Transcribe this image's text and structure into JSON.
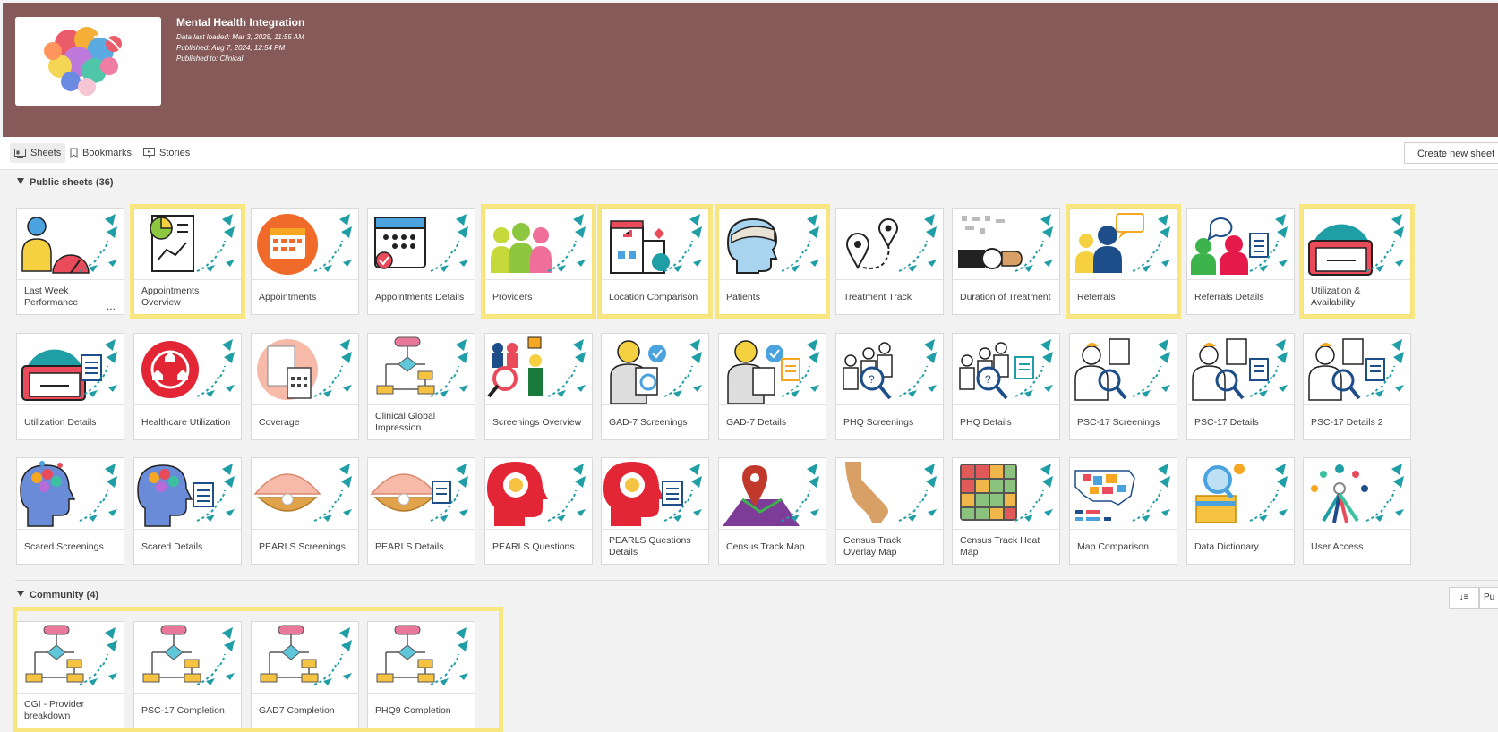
{
  "app": {
    "title": "Mental Health Integration",
    "data_last_loaded": "Data last loaded: Mar 3, 2025, 11:55 AM",
    "published": "Published: Aug 7, 2024, 12:54 PM",
    "published_to": "Published to: Clinical"
  },
  "tabs": [
    {
      "label": "Sheets",
      "icon": "sheets-icon",
      "active": true
    },
    {
      "label": "Bookmarks",
      "icon": "bookmark-icon",
      "active": false
    },
    {
      "label": "Stories",
      "icon": "stories-icon",
      "active": false
    }
  ],
  "create_sheet_label": "Create new sheet",
  "public_section": {
    "title": "Public sheets (36)",
    "sheets": [
      {
        "label": "Last Week Performance",
        "icon": "person-gauge-icon",
        "more": "..."
      },
      {
        "label": "Appointments Overview",
        "icon": "chart-report-icon",
        "highlighted": true
      },
      {
        "label": "Appointments",
        "icon": "appointments-calendar-icon"
      },
      {
        "label": "Appointments Details",
        "icon": "calendar-check-icon"
      },
      {
        "label": "Providers",
        "icon": "providers-group-icon",
        "highlighted": true
      },
      {
        "label": "Location Comparison",
        "icon": "hospital-building-icon",
        "highlighted": true
      },
      {
        "label": "Patients",
        "icon": "bandaged-head-icon",
        "highlighted": true
      },
      {
        "label": "Treatment Track",
        "icon": "route-pins-icon"
      },
      {
        "label": "Duration of Treatment",
        "icon": "wristwatch-icon"
      },
      {
        "label": "Referrals",
        "icon": "doctor-speech-icon",
        "highlighted": true
      },
      {
        "label": "Referrals Details",
        "icon": "people-speech-list-icon"
      },
      {
        "label": "Utilization & Availability",
        "icon": "folder-gauge-icon",
        "highlighted": true
      },
      {
        "label": "Utilization Details",
        "icon": "folder-gauge-list-icon"
      },
      {
        "label": "Healthcare Utilization",
        "icon": "home-cycle-icon"
      },
      {
        "label": "Coverage",
        "icon": "calculator-receipt-icon"
      },
      {
        "label": "Clinical Global Impression",
        "icon": "flowchart-icon"
      },
      {
        "label": "Screenings Overview",
        "icon": "screening-people-icon"
      },
      {
        "label": "GAD-7 Screenings",
        "icon": "patient-check-icon"
      },
      {
        "label": "GAD-7 Details",
        "icon": "patient-check-list-icon"
      },
      {
        "label": "PHQ Screenings",
        "icon": "people-magnifier-icon"
      },
      {
        "label": "PHQ Details",
        "icon": "people-magnifier-list-icon"
      },
      {
        "label": "PSC-17 Screenings",
        "icon": "person-document-search-icon"
      },
      {
        "label": "PSC-17 Details",
        "icon": "person-document-list-icon"
      },
      {
        "label": "PSC-17 Details 2",
        "icon": "person-document-list-icon"
      },
      {
        "label": "Scared Screenings",
        "icon": "brain-head-icon"
      },
      {
        "label": "Scared Details",
        "icon": "brain-head-list-icon"
      },
      {
        "label": "PEARLS Screenings",
        "icon": "pearl-shell-icon"
      },
      {
        "label": "PEARLS Details",
        "icon": "pearl-shell-list-icon"
      },
      {
        "label": "PEARLS Questions",
        "icon": "sun-head-icon"
      },
      {
        "label": "PEARLS Questions Details",
        "icon": "sun-head-list-icon"
      },
      {
        "label": "Census Track Map",
        "icon": "map-pin-icon"
      },
      {
        "label": "Census Track Overlay Map",
        "icon": "california-map-icon"
      },
      {
        "label": "Census Track Heat Map",
        "icon": "heat-grid-icon"
      },
      {
        "label": "Map Comparison",
        "icon": "us-map-icon"
      },
      {
        "label": "Data Dictionary",
        "icon": "dictionary-magnifier-icon"
      },
      {
        "label": "User Access",
        "icon": "user-keys-icon"
      }
    ]
  },
  "community_section": {
    "title": "Community (4)",
    "sheets": [
      {
        "label": "CGI - Provider breakdown",
        "icon": "flowchart-icon"
      },
      {
        "label": "PSC-17 Completion",
        "icon": "flowchart-icon"
      },
      {
        "label": "GAD7 Completion",
        "icon": "flowchart-icon"
      },
      {
        "label": "PHQ9 Completion",
        "icon": "flowchart-icon"
      }
    ]
  },
  "sort_label": "↓≡",
  "publish_label": "Pu",
  "colors": {
    "header": "#855a58",
    "highlight": "#fae25a",
    "accent_teal": "#1f9ea6"
  }
}
